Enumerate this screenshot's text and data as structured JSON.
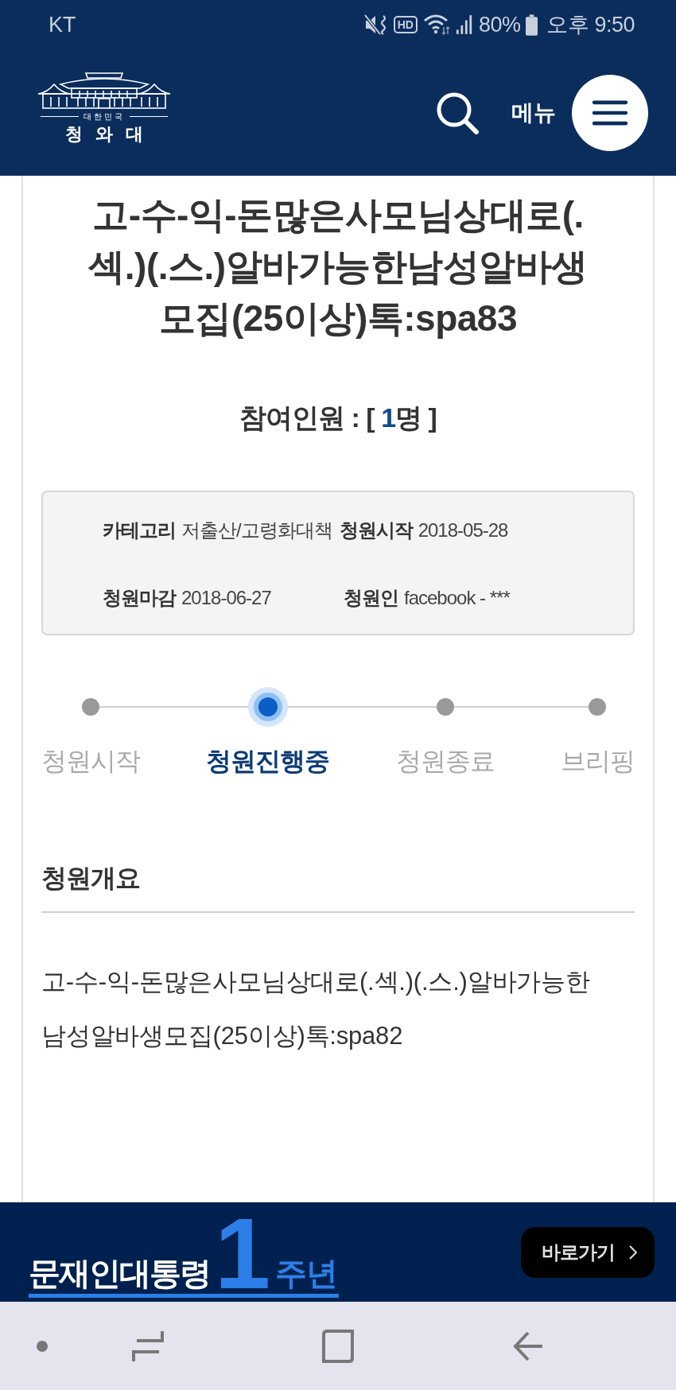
{
  "status_bar": {
    "carrier": "KT",
    "call_badge": "HD",
    "battery": "80%",
    "time": "오후 9:50"
  },
  "header": {
    "logo": {
      "subtitle": "대한민국",
      "name": "청와대"
    },
    "menu_label": "메뉴"
  },
  "petition": {
    "title": "고-수-익-돈많은사모님상대로(.섹.)(.스.)알바가능한남성알바생모집(25이상)톡:spa83",
    "participants": {
      "prefix": "참여인원 : [",
      "count": "1",
      "suffix": "명 ]"
    },
    "info_rows": [
      {
        "fields": [
          {
            "label": "카테고리",
            "value": "저출산/고령화대책"
          },
          {
            "label": "청원시작",
            "value": "2018-05-28"
          }
        ]
      },
      {
        "fields": [
          {
            "label": "청원마감",
            "value": "2018-06-27"
          },
          {
            "label": "청원인",
            "value": "facebook - ***"
          }
        ]
      }
    ],
    "steps": [
      {
        "label": "청원시작",
        "selected": false
      },
      {
        "label": "청원진행중",
        "selected": true
      },
      {
        "label": "청원종료",
        "selected": false
      },
      {
        "label": "브리핑",
        "selected": false
      }
    ],
    "summary": {
      "heading": "청원개요",
      "body": "고-수-익-돈많은사모님상대로(.섹.)(.스.)알바가능한남성알바생모집(25이상)톡:spa82"
    }
  },
  "banner": {
    "title": "문재인대통령",
    "number": "1",
    "suffix": "주년",
    "button": "바로가기"
  }
}
